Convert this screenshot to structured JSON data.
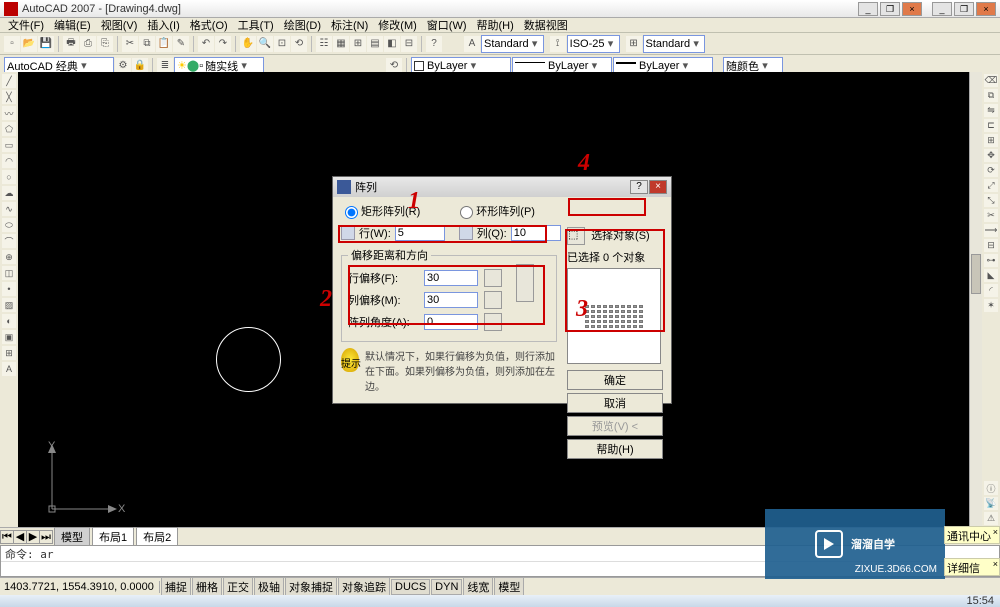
{
  "app": {
    "title": "AutoCAD 2007 - [Drawing4.dwg]"
  },
  "menu": [
    "文件(F)",
    "编辑(E)",
    "视图(V)",
    "插入(I)",
    "格式(O)",
    "工具(T)",
    "绘图(D)",
    "标注(N)",
    "修改(M)",
    "窗口(W)",
    "帮助(H)",
    "数据视图"
  ],
  "tb2": {
    "workspace": "AutoCAD 经典",
    "linetype_label": "随实线",
    "layer": "ByLayer",
    "linetype": "ByLayer",
    "lineweight": "ByLayer",
    "color": "随颜色"
  },
  "tb1": {
    "textstyle": "Standard",
    "dimstyle": "ISO-25",
    "tablestyle": "Standard"
  },
  "dialog": {
    "title": "阵列",
    "radio_rect": "矩形阵列(R)",
    "radio_polar": "环形阵列(P)",
    "rows_label": "行(W):",
    "rows_value": "5",
    "cols_label": "列(Q):",
    "cols_value": "10",
    "offset_group": "偏移距离和方向",
    "row_offset_label": "行偏移(F):",
    "row_offset_value": "30",
    "col_offset_label": "列偏移(M):",
    "col_offset_value": "30",
    "angle_label": "阵列角度(A):",
    "angle_value": "0",
    "tip_label": "提示",
    "tip_text": "默认情况下，如果行偏移为负值，则行添加在下面。如果列偏移为负值，则列添加在左边。",
    "select_label": "选择对象(S)",
    "selected_info": "已选择 0 个对象",
    "btn_ok": "确定",
    "btn_cancel": "取消",
    "btn_preview": "预览(V) <",
    "btn_help": "帮助(H)"
  },
  "annotations": {
    "a1": "1",
    "a2": "2",
    "a3": "3",
    "a4": "4"
  },
  "tabs": {
    "model": "模型",
    "layout1": "布局1",
    "layout2": "布局2"
  },
  "cmd": {
    "line1": "命令: ar"
  },
  "status": {
    "coords": "1403.7721, 1554.3910, 0.0000",
    "modes": [
      "捕捉",
      "栅格",
      "正交",
      "极轴",
      "对象捕捉",
      "对象追踪",
      "DUCS",
      "DYN",
      "线宽",
      "模型"
    ]
  },
  "ucs": {
    "x": "X",
    "y": "Y"
  },
  "watermark": {
    "text": "溜溜自学",
    "url": "ZIXUE.3D66.COM"
  },
  "notif1": "通讯中心",
  "notif2": "详细信息...",
  "clock": "15:54"
}
